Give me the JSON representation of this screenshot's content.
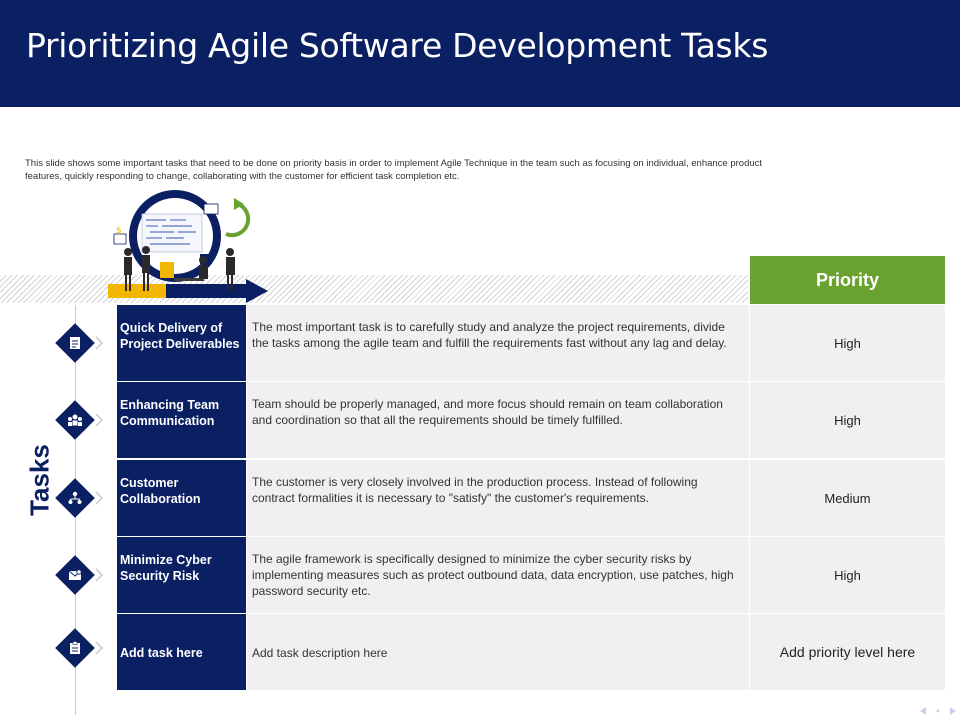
{
  "title": "Prioritizing Agile Software Development Tasks",
  "intro": "This slide shows some important tasks that need to be done on priority basis in order to implement Agile Technique in the team such as focusing on individual, enhance product features, quickly responding to change, collaborating with the customer for efficient task completion etc.",
  "tasks_label": "Tasks",
  "priority_header": "Priority",
  "rows": [
    {
      "name": "Quick Delivery of Project Deliverables",
      "description": "The most important task is to carefully study and analyze the project requirements, divide the tasks among the agile team and fulfill the requirements fast without any lag and delay.",
      "priority": "High",
      "icon": "document-icon"
    },
    {
      "name": "Enhancing Team Communication",
      "description": "Team should be properly managed, and more focus should remain on team collaboration and coordination so that all the requirements should be timely fulfilled.",
      "priority": "High",
      "icon": "team-icon"
    },
    {
      "name": "Customer Collaboration",
      "description": "The customer is very closely involved  in the production process. Instead of following contract formalities it is necessary to \"satisfy\" the customer's requirements.",
      "priority": "Medium",
      "icon": "network-icon"
    },
    {
      "name": "Minimize Cyber Security Risk",
      "description": "The agile framework  is specifically designed to minimize the cyber security risks by implementing measures such as protect outbound data, data encryption, use patches, high password security etc.",
      "priority": "High",
      "icon": "secure-mail-icon"
    },
    {
      "name": "Add task here",
      "description": "Add task description here",
      "priority": "Add priority level here",
      "icon": "clipboard-icon"
    }
  ],
  "colors": {
    "navy": "#0b1f63",
    "green": "#6aa22f",
    "cell": "#f0f0f0"
  }
}
